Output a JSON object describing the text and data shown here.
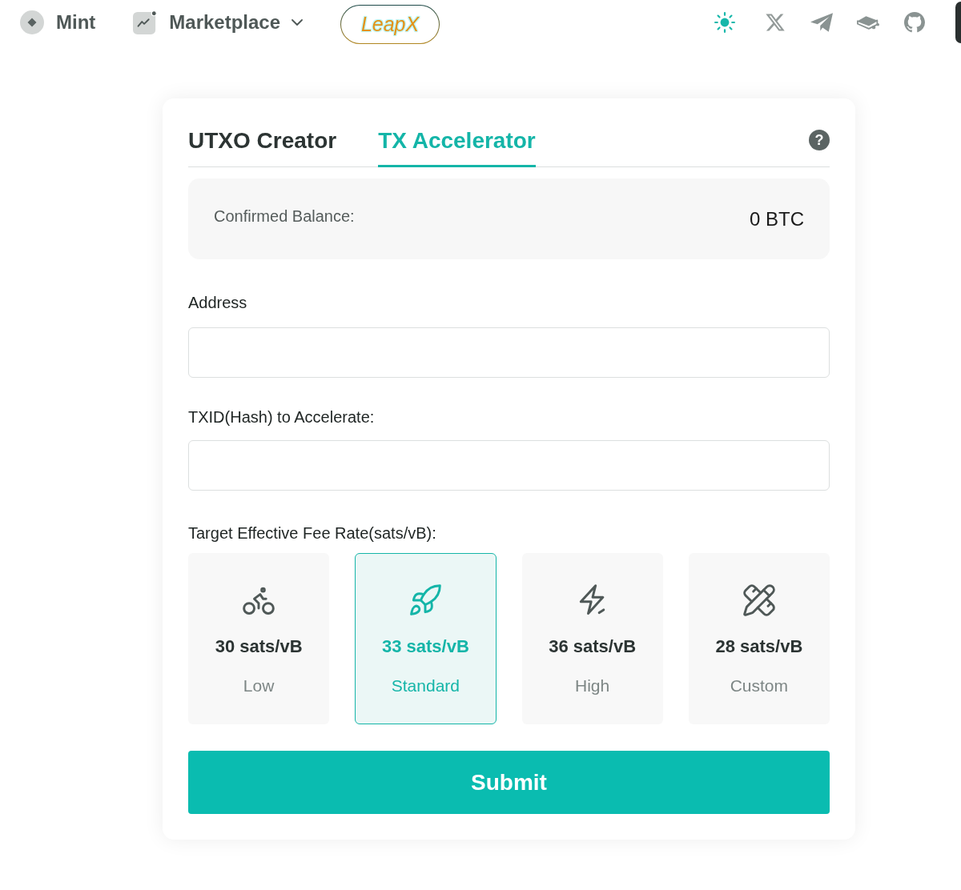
{
  "nav": {
    "items": [
      {
        "label": "Mint",
        "kind": "link"
      },
      {
        "label": "Marketplace",
        "kind": "dropdown"
      }
    ],
    "logo": {
      "label": "LeapX"
    }
  },
  "tabs": [
    {
      "label": "UTXO Creator",
      "selected": false
    },
    {
      "label": "TX Accelerator",
      "selected": true
    }
  ],
  "help": {
    "label": "?"
  },
  "balance": {
    "label": "Confirmed Balance:",
    "value": "0 BTC"
  },
  "fields": [
    {
      "label": "Address"
    },
    {
      "label": "TXID(Hash) to Accelerate:"
    }
  ],
  "fee_rate": {
    "label": "Target Effective Fee Rate(sats/vB):",
    "options": [
      {
        "kind": "bicycle",
        "rate": "30 sats/vB",
        "name": "Low",
        "selected": false
      },
      {
        "kind": "rocket",
        "rate": "33 sats/vB",
        "name": "Standard",
        "selected": true
      },
      {
        "kind": "bolt",
        "rate": "36 sats/vB",
        "name": "High",
        "selected": false
      },
      {
        "kind": "tools",
        "rate": "28 sats/vB",
        "name": "Custom",
        "selected": false
      }
    ]
  },
  "submit": {
    "label": "Submit"
  }
}
